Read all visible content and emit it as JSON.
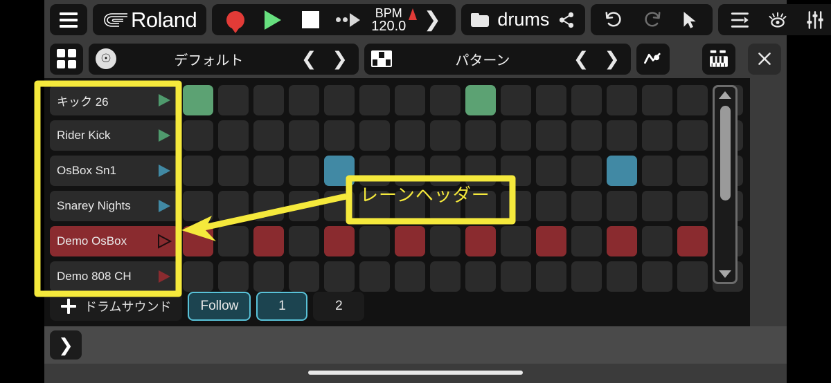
{
  "top_toolbar": {
    "menu_icon": "hamburger-menu-icon",
    "brand": "Roland",
    "transport": {
      "record_icon": "record-icon",
      "play_icon": "play-icon",
      "stop_icon": "stop-icon",
      "loop_icon": "loop-play-icon",
      "bpm_label": "BPM",
      "bpm_value": "120.0",
      "metronome_icon": "metronome-icon",
      "expand_icon": "chevron-right-icon"
    },
    "project": {
      "folder_icon": "folder-icon",
      "name": "drums",
      "share_icon": "share-icon"
    },
    "edit": {
      "undo_icon": "undo-icon",
      "redo_icon": "redo-icon",
      "pointer_icon": "pointer-arrow-icon"
    },
    "view": {
      "align_icon": "align-right-icon",
      "eye_icon": "eye-icon",
      "mixer_icon": "mixer-faders-icon",
      "grid_icon": "grid-icon"
    }
  },
  "second_toolbar": {
    "grid_view_icon": "four-squares-icon",
    "kit_selector": {
      "icon": "drum-kit-icon",
      "label": "デフォルト",
      "prev_icon": "chevron-left-icon",
      "next_icon": "chevron-right-icon"
    },
    "pattern_selector": {
      "icon": "pattern-icon",
      "label": "パターン",
      "prev_icon": "chevron-left-icon",
      "next_icon": "chevron-right-icon"
    },
    "automation_icon": "automation-curve-icon",
    "keyboard_icon": "keyboard-icon",
    "close_icon": "close-x-icon"
  },
  "lanes": [
    {
      "name": "キック 26",
      "play_icon": "play-icon",
      "color": "#4f9a6d",
      "tri_class": "",
      "selected": false
    },
    {
      "name": "Rider Kick",
      "play_icon": "play-icon",
      "color": "#4f9a6d",
      "tri_class": "",
      "selected": false
    },
    {
      "name": "OsBox Sn1",
      "play_icon": "play-icon",
      "color": "#4189a4",
      "tri_class": "blue",
      "selected": false
    },
    {
      "name": "Snarey Nights",
      "play_icon": "play-icon",
      "color": "#4189a4",
      "tri_class": "blue",
      "selected": false
    },
    {
      "name": "Demo OsBox",
      "play_icon": "play-icon",
      "color": "#2a1214",
      "tri_class": "outline",
      "selected": true
    },
    {
      "name": "Demo 808 CH",
      "play_icon": "play-icon",
      "color": "#8a2b2f",
      "tri_class": "red",
      "selected": false
    }
  ],
  "sequencer": {
    "columns": 16,
    "rows": [
      {
        "lane": "キック 26",
        "active_class": "g",
        "steps": [
          1,
          0,
          0,
          0,
          0,
          0,
          0,
          0,
          1,
          0,
          0,
          0,
          0,
          0,
          0,
          0
        ]
      },
      {
        "lane": "Rider Kick",
        "active_class": "g",
        "steps": [
          0,
          0,
          0,
          0,
          0,
          0,
          0,
          0,
          0,
          0,
          0,
          0,
          0,
          0,
          0,
          0
        ]
      },
      {
        "lane": "OsBox Sn1",
        "active_class": "b",
        "steps": [
          0,
          0,
          0,
          0,
          1,
          0,
          0,
          0,
          0,
          0,
          0,
          0,
          1,
          0,
          0,
          0
        ]
      },
      {
        "lane": "Snarey Nights",
        "active_class": "b",
        "steps": [
          0,
          0,
          0,
          0,
          0,
          0,
          0,
          0,
          0,
          0,
          0,
          0,
          0,
          0,
          0,
          0
        ]
      },
      {
        "lane": "Demo OsBox",
        "active_class": "r",
        "steps": [
          1,
          0,
          1,
          0,
          1,
          0,
          1,
          0,
          1,
          0,
          1,
          0,
          1,
          0,
          1,
          0
        ]
      },
      {
        "lane": "Demo 808 CH",
        "active_class": "r",
        "steps": [
          0,
          0,
          0,
          0,
          0,
          0,
          0,
          0,
          0,
          0,
          0,
          0,
          0,
          0,
          0,
          0
        ]
      }
    ]
  },
  "scrollbar": {
    "up_icon": "triangle-up-icon",
    "down_icon": "triangle-down-icon",
    "thumb": "scroll-thumb"
  },
  "bottom_bar": {
    "add_sound_label": "ドラムサウンド",
    "add_icon": "plus-icon",
    "follow_label": "Follow",
    "follow_active": true,
    "pages": [
      {
        "label": "1",
        "active": true
      },
      {
        "label": "2",
        "active": false
      }
    ]
  },
  "footer": {
    "expand_icon": "chevron-right-icon"
  },
  "annotation": {
    "text": "レーンヘッダー",
    "color": "#f5e93c",
    "highlight_target": "lane-headers-column"
  },
  "colors": {
    "accent_green": "#5ca273",
    "accent_blue": "#4189a4",
    "accent_red": "#8a2b2f",
    "selected_lane": "#8a2b2f",
    "annotation_yellow": "#f5e93c",
    "follow_teal": "#1c4450",
    "follow_border": "#59c2d8"
  }
}
